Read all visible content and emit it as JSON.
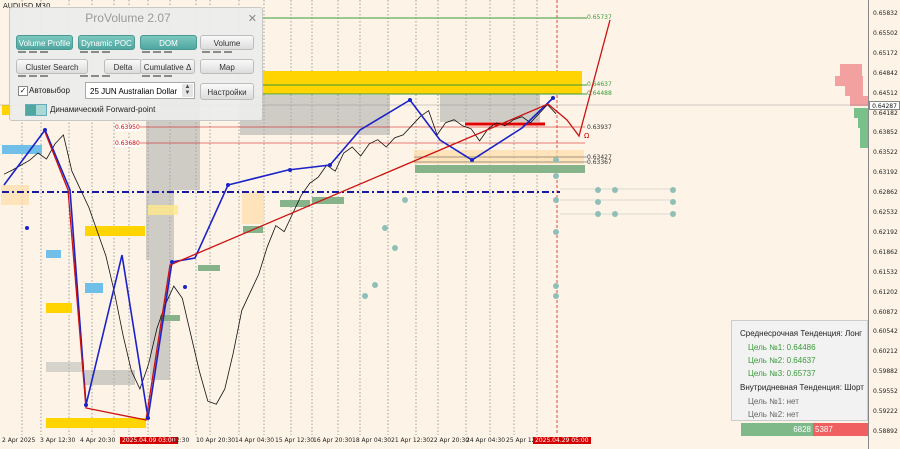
{
  "symbol": "AUDUSD,M30",
  "panel": {
    "title": "ProVolume 2.07",
    "close": "✕",
    "buttons": {
      "volume_profile": "Volume Profile",
      "dynamic_poc": "Dynamic POC",
      "dom": "DOM",
      "volume": "Volume",
      "cluster_search": "Cluster Search",
      "delta": "Delta",
      "cumulative_delta": "Cumulative Δ",
      "map": "Map",
      "settings": "Настройки"
    },
    "auto_select_label": "Автовыбор",
    "auto_select_checked": "✓",
    "instrument": "25 JUN Australian Dollar",
    "forward_point_label": "Динамический Forward-point"
  },
  "price_axis": {
    "labels": [
      "0.65832",
      "0.65502",
      "0.65172",
      "0.64842",
      "0.64512",
      "0.64182",
      "0.63852",
      "0.63522",
      "0.63192",
      "0.62862",
      "0.62532",
      "0.62192",
      "0.61862",
      "0.61532",
      "0.61202",
      "0.60872",
      "0.60542",
      "0.60212",
      "0.59882",
      "0.59552",
      "0.59222",
      "0.58892"
    ],
    "current": "0.64287"
  },
  "time_axis": [
    {
      "label": "2 Apr 2025",
      "hl": false
    },
    {
      "label": "3 Apr 12:30",
      "hl": false
    },
    {
      "label": "4 Apr 20:30",
      "hl": false
    },
    {
      "label": "2025.04.09 03:00",
      "hl": true
    },
    {
      "label": "12:30",
      "hl": false
    },
    {
      "label": "10 Apr 20:30",
      "hl": false
    },
    {
      "label": "14 Apr 04:30",
      "hl": false
    },
    {
      "label": "15 Apr 12:30",
      "hl": false
    },
    {
      "label": "16 Apr 20:30",
      "hl": false
    },
    {
      "label": "18 Apr 04:30",
      "hl": false
    },
    {
      "label": "21 Apr 12:30",
      "hl": false
    },
    {
      "label": "22 Apr 20:30",
      "hl": false
    },
    {
      "label": "24 Apr 04:30",
      "hl": false
    },
    {
      "label": "25 Apr 12",
      "hl": false
    },
    {
      "label": "2025.04.29 05:00",
      "hl": true
    }
  ],
  "levels": {
    "l1": "0.65737",
    "l2": "0.64637",
    "l3": "0.64488",
    "l4": "0.63950",
    "l5": "0.63680",
    "l6": "0.63937",
    "l7": "0.63427",
    "l8": "0.63367",
    "marker": "Ω"
  },
  "trend": {
    "mid_title": "Среднесрочная Тенденция: Лонг",
    "mid_t1": "Цель №1: 0.64486",
    "mid_t2": "Цель №2: 0.64637",
    "mid_t3": "Цель №3: 0.65737",
    "intra_title": "Внутридневная Тенденция: Шорт",
    "intra_t1": "Цель №1: нет",
    "intra_t2": "Цель №2: нет"
  },
  "volume_bar": {
    "buy": "6828",
    "sell": "5387"
  },
  "colors": {
    "background": "#fdf4e7",
    "target_green": "#3a9a3a",
    "zigzag_blue": "#1a22c8",
    "zigzag_red": "#cc1111",
    "zone_yellow": "#ffd400"
  },
  "chart_data": {
    "type": "line",
    "price_range": [
      0.5889,
      0.6583
    ],
    "close_series": [
      0.6315,
      0.6322,
      0.633,
      0.6338,
      0.635,
      0.634,
      0.6365,
      0.638,
      0.632,
      0.629,
      0.626,
      0.622,
      0.618,
      0.612,
      0.605,
      0.599,
      0.596,
      0.6,
      0.606,
      0.61,
      0.613,
      0.611,
      0.605,
      0.599,
      0.594,
      0.5935,
      0.596,
      0.602,
      0.609,
      0.612,
      0.615,
      0.6195,
      0.623,
      0.622,
      0.625,
      0.628,
      0.63,
      0.631,
      0.633,
      0.632,
      0.635,
      0.636,
      0.6345,
      0.6365,
      0.6372,
      0.636,
      0.6375,
      0.638,
      0.6395,
      0.641,
      0.642,
      0.638,
      0.64,
      0.6405,
      0.6395,
      0.639,
      0.637,
      0.639,
      0.64,
      0.6395,
      0.6405,
      0.641,
      0.64,
      0.6415,
      0.643,
      0.6415
    ]
  }
}
